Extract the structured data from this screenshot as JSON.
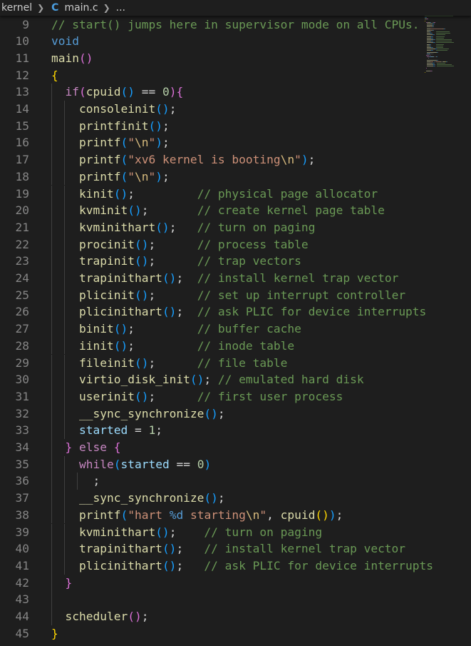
{
  "breadcrumb": {
    "folder": "kernel",
    "file": "main.c",
    "more": "..."
  },
  "lines": [
    {
      "n": "9",
      "indent": 0,
      "tokens": [
        {
          "t": "// start() jumps here in supervisor mode on all CPUs.",
          "c": "cm"
        }
      ]
    },
    {
      "n": "10",
      "indent": 0,
      "tokens": [
        {
          "t": "void",
          "c": "ty"
        }
      ]
    },
    {
      "n": "11",
      "indent": 0,
      "tokens": [
        {
          "t": "main",
          "c": "fn"
        },
        {
          "t": "()",
          "c": "b2"
        }
      ]
    },
    {
      "n": "12",
      "indent": 0,
      "tokens": [
        {
          "t": "{",
          "c": "b1"
        }
      ]
    },
    {
      "n": "13",
      "indent": 1,
      "tokens": [
        {
          "t": "  ",
          "c": "op"
        },
        {
          "t": "if",
          "c": "kw"
        },
        {
          "t": "(",
          "c": "b2"
        },
        {
          "t": "cpuid",
          "c": "fn"
        },
        {
          "t": "()",
          "c": "b3"
        },
        {
          "t": " == ",
          "c": "op"
        },
        {
          "t": "0",
          "c": "num"
        },
        {
          "t": ")",
          "c": "b2"
        },
        {
          "t": "{",
          "c": "b2"
        }
      ]
    },
    {
      "n": "14",
      "indent": 2,
      "tokens": [
        {
          "t": "    ",
          "c": "op"
        },
        {
          "t": "consoleinit",
          "c": "fn"
        },
        {
          "t": "()",
          "c": "b3"
        },
        {
          "t": ";",
          "c": "op"
        }
      ]
    },
    {
      "n": "15",
      "indent": 2,
      "tokens": [
        {
          "t": "    ",
          "c": "op"
        },
        {
          "t": "printfinit",
          "c": "fn"
        },
        {
          "t": "()",
          "c": "b3"
        },
        {
          "t": ";",
          "c": "op"
        }
      ]
    },
    {
      "n": "16",
      "indent": 2,
      "tokens": [
        {
          "t": "    ",
          "c": "op"
        },
        {
          "t": "printf",
          "c": "fn"
        },
        {
          "t": "(",
          "c": "b3"
        },
        {
          "t": "\"",
          "c": "str"
        },
        {
          "t": "\\n",
          "c": "esc"
        },
        {
          "t": "\"",
          "c": "str"
        },
        {
          "t": ")",
          "c": "b3"
        },
        {
          "t": ";",
          "c": "op"
        }
      ]
    },
    {
      "n": "17",
      "indent": 2,
      "tokens": [
        {
          "t": "    ",
          "c": "op"
        },
        {
          "t": "printf",
          "c": "fn"
        },
        {
          "t": "(",
          "c": "b3"
        },
        {
          "t": "\"xv6 kernel is booting",
          "c": "str"
        },
        {
          "t": "\\n",
          "c": "esc"
        },
        {
          "t": "\"",
          "c": "str"
        },
        {
          "t": ")",
          "c": "b3"
        },
        {
          "t": ";",
          "c": "op"
        }
      ]
    },
    {
      "n": "18",
      "indent": 2,
      "tokens": [
        {
          "t": "    ",
          "c": "op"
        },
        {
          "t": "printf",
          "c": "fn"
        },
        {
          "t": "(",
          "c": "b3"
        },
        {
          "t": "\"",
          "c": "str"
        },
        {
          "t": "\\n",
          "c": "esc"
        },
        {
          "t": "\"",
          "c": "str"
        },
        {
          "t": ")",
          "c": "b3"
        },
        {
          "t": ";",
          "c": "op"
        }
      ]
    },
    {
      "n": "19",
      "indent": 2,
      "tokens": [
        {
          "t": "    ",
          "c": "op"
        },
        {
          "t": "kinit",
          "c": "fn"
        },
        {
          "t": "()",
          "c": "b3"
        },
        {
          "t": ";         ",
          "c": "op"
        },
        {
          "t": "// physical page allocator",
          "c": "cm"
        }
      ]
    },
    {
      "n": "20",
      "indent": 2,
      "tokens": [
        {
          "t": "    ",
          "c": "op"
        },
        {
          "t": "kvminit",
          "c": "fn"
        },
        {
          "t": "()",
          "c": "b3"
        },
        {
          "t": ";       ",
          "c": "op"
        },
        {
          "t": "// create kernel page table",
          "c": "cm"
        }
      ]
    },
    {
      "n": "21",
      "indent": 2,
      "tokens": [
        {
          "t": "    ",
          "c": "op"
        },
        {
          "t": "kvminithart",
          "c": "fn"
        },
        {
          "t": "()",
          "c": "b3"
        },
        {
          "t": ";   ",
          "c": "op"
        },
        {
          "t": "// turn on paging",
          "c": "cm"
        }
      ]
    },
    {
      "n": "22",
      "indent": 2,
      "tokens": [
        {
          "t": "    ",
          "c": "op"
        },
        {
          "t": "procinit",
          "c": "fn"
        },
        {
          "t": "()",
          "c": "b3"
        },
        {
          "t": ";      ",
          "c": "op"
        },
        {
          "t": "// process table",
          "c": "cm"
        }
      ]
    },
    {
      "n": "23",
      "indent": 2,
      "tokens": [
        {
          "t": "    ",
          "c": "op"
        },
        {
          "t": "trapinit",
          "c": "fn"
        },
        {
          "t": "()",
          "c": "b3"
        },
        {
          "t": ";      ",
          "c": "op"
        },
        {
          "t": "// trap vectors",
          "c": "cm"
        }
      ]
    },
    {
      "n": "24",
      "indent": 2,
      "tokens": [
        {
          "t": "    ",
          "c": "op"
        },
        {
          "t": "trapinithart",
          "c": "fn"
        },
        {
          "t": "()",
          "c": "b3"
        },
        {
          "t": ";  ",
          "c": "op"
        },
        {
          "t": "// install kernel trap vector",
          "c": "cm"
        }
      ]
    },
    {
      "n": "25",
      "indent": 2,
      "tokens": [
        {
          "t": "    ",
          "c": "op"
        },
        {
          "t": "plicinit",
          "c": "fn"
        },
        {
          "t": "()",
          "c": "b3"
        },
        {
          "t": ";      ",
          "c": "op"
        },
        {
          "t": "// set up interrupt controller",
          "c": "cm"
        }
      ]
    },
    {
      "n": "26",
      "indent": 2,
      "tokens": [
        {
          "t": "    ",
          "c": "op"
        },
        {
          "t": "plicinithart",
          "c": "fn"
        },
        {
          "t": "()",
          "c": "b3"
        },
        {
          "t": ";  ",
          "c": "op"
        },
        {
          "t": "// ask PLIC for device interrupts",
          "c": "cm"
        }
      ]
    },
    {
      "n": "27",
      "indent": 2,
      "tokens": [
        {
          "t": "    ",
          "c": "op"
        },
        {
          "t": "binit",
          "c": "fn"
        },
        {
          "t": "()",
          "c": "b3"
        },
        {
          "t": ";         ",
          "c": "op"
        },
        {
          "t": "// buffer cache",
          "c": "cm"
        }
      ]
    },
    {
      "n": "28",
      "indent": 2,
      "tokens": [
        {
          "t": "    ",
          "c": "op"
        },
        {
          "t": "iinit",
          "c": "fn"
        },
        {
          "t": "()",
          "c": "b3"
        },
        {
          "t": ";         ",
          "c": "op"
        },
        {
          "t": "// inode table",
          "c": "cm"
        }
      ]
    },
    {
      "n": "29",
      "indent": 2,
      "tokens": [
        {
          "t": "    ",
          "c": "op"
        },
        {
          "t": "fileinit",
          "c": "fn"
        },
        {
          "t": "()",
          "c": "b3"
        },
        {
          "t": ";      ",
          "c": "op"
        },
        {
          "t": "// file table",
          "c": "cm"
        }
      ]
    },
    {
      "n": "30",
      "indent": 2,
      "tokens": [
        {
          "t": "    ",
          "c": "op"
        },
        {
          "t": "virtio_disk_init",
          "c": "fn"
        },
        {
          "t": "()",
          "c": "b3"
        },
        {
          "t": "; ",
          "c": "op"
        },
        {
          "t": "// emulated hard disk",
          "c": "cm"
        }
      ]
    },
    {
      "n": "31",
      "indent": 2,
      "tokens": [
        {
          "t": "    ",
          "c": "op"
        },
        {
          "t": "userinit",
          "c": "fn"
        },
        {
          "t": "()",
          "c": "b3"
        },
        {
          "t": ";      ",
          "c": "op"
        },
        {
          "t": "// first user process",
          "c": "cm"
        }
      ]
    },
    {
      "n": "32",
      "indent": 2,
      "tokens": [
        {
          "t": "    ",
          "c": "op"
        },
        {
          "t": "__sync_synchronize",
          "c": "fn"
        },
        {
          "t": "()",
          "c": "b3"
        },
        {
          "t": ";",
          "c": "op"
        }
      ]
    },
    {
      "n": "33",
      "indent": 2,
      "tokens": [
        {
          "t": "    ",
          "c": "op"
        },
        {
          "t": "started",
          "c": "var"
        },
        {
          "t": " = ",
          "c": "op"
        },
        {
          "t": "1",
          "c": "num"
        },
        {
          "t": ";",
          "c": "op"
        }
      ]
    },
    {
      "n": "34",
      "indent": 1,
      "tokens": [
        {
          "t": "  ",
          "c": "op"
        },
        {
          "t": "}",
          "c": "b2"
        },
        {
          "t": " ",
          "c": "op"
        },
        {
          "t": "else",
          "c": "kw"
        },
        {
          "t": " ",
          "c": "op"
        },
        {
          "t": "{",
          "c": "b2"
        }
      ]
    },
    {
      "n": "35",
      "indent": 2,
      "tokens": [
        {
          "t": "    ",
          "c": "op"
        },
        {
          "t": "while",
          "c": "kw"
        },
        {
          "t": "(",
          "c": "b3"
        },
        {
          "t": "started",
          "c": "var"
        },
        {
          "t": " == ",
          "c": "op"
        },
        {
          "t": "0",
          "c": "num"
        },
        {
          "t": ")",
          "c": "b3"
        }
      ]
    },
    {
      "n": "36",
      "indent": 3,
      "tokens": [
        {
          "t": "      ;",
          "c": "op"
        }
      ]
    },
    {
      "n": "37",
      "indent": 2,
      "tokens": [
        {
          "t": "    ",
          "c": "op"
        },
        {
          "t": "__sync_synchronize",
          "c": "fn"
        },
        {
          "t": "()",
          "c": "b3"
        },
        {
          "t": ";",
          "c": "op"
        }
      ]
    },
    {
      "n": "38",
      "indent": 2,
      "tokens": [
        {
          "t": "    ",
          "c": "op"
        },
        {
          "t": "printf",
          "c": "fn"
        },
        {
          "t": "(",
          "c": "b3"
        },
        {
          "t": "\"hart ",
          "c": "str"
        },
        {
          "t": "%d",
          "c": "ty"
        },
        {
          "t": " starting",
          "c": "str"
        },
        {
          "t": "\\n",
          "c": "esc"
        },
        {
          "t": "\"",
          "c": "str"
        },
        {
          "t": ", ",
          "c": "op"
        },
        {
          "t": "cpuid",
          "c": "fn"
        },
        {
          "t": "()",
          "c": "b1"
        },
        {
          "t": ")",
          "c": "b3"
        },
        {
          "t": ";",
          "c": "op"
        }
      ]
    },
    {
      "n": "39",
      "indent": 2,
      "tokens": [
        {
          "t": "    ",
          "c": "op"
        },
        {
          "t": "kvminithart",
          "c": "fn"
        },
        {
          "t": "()",
          "c": "b3"
        },
        {
          "t": ";    ",
          "c": "op"
        },
        {
          "t": "// turn on paging",
          "c": "cm"
        }
      ]
    },
    {
      "n": "40",
      "indent": 2,
      "tokens": [
        {
          "t": "    ",
          "c": "op"
        },
        {
          "t": "trapinithart",
          "c": "fn"
        },
        {
          "t": "()",
          "c": "b3"
        },
        {
          "t": ";   ",
          "c": "op"
        },
        {
          "t": "// install kernel trap vector",
          "c": "cm"
        }
      ]
    },
    {
      "n": "41",
      "indent": 2,
      "tokens": [
        {
          "t": "    ",
          "c": "op"
        },
        {
          "t": "plicinithart",
          "c": "fn"
        },
        {
          "t": "()",
          "c": "b3"
        },
        {
          "t": ";   ",
          "c": "op"
        },
        {
          "t": "// ask PLIC for device interrupts",
          "c": "cm"
        }
      ]
    },
    {
      "n": "42",
      "indent": 1,
      "tokens": [
        {
          "t": "  ",
          "c": "op"
        },
        {
          "t": "}",
          "c": "b2"
        }
      ]
    },
    {
      "n": "43",
      "indent": 1,
      "tokens": []
    },
    {
      "n": "44",
      "indent": 1,
      "tokens": [
        {
          "t": "  ",
          "c": "op"
        },
        {
          "t": "scheduler",
          "c": "fn"
        },
        {
          "t": "()",
          "c": "b2"
        },
        {
          "t": ";",
          "c": "op"
        }
      ]
    },
    {
      "n": "45",
      "indent": 0,
      "tokens": [
        {
          "t": "}",
          "c": "b1"
        }
      ]
    }
  ]
}
